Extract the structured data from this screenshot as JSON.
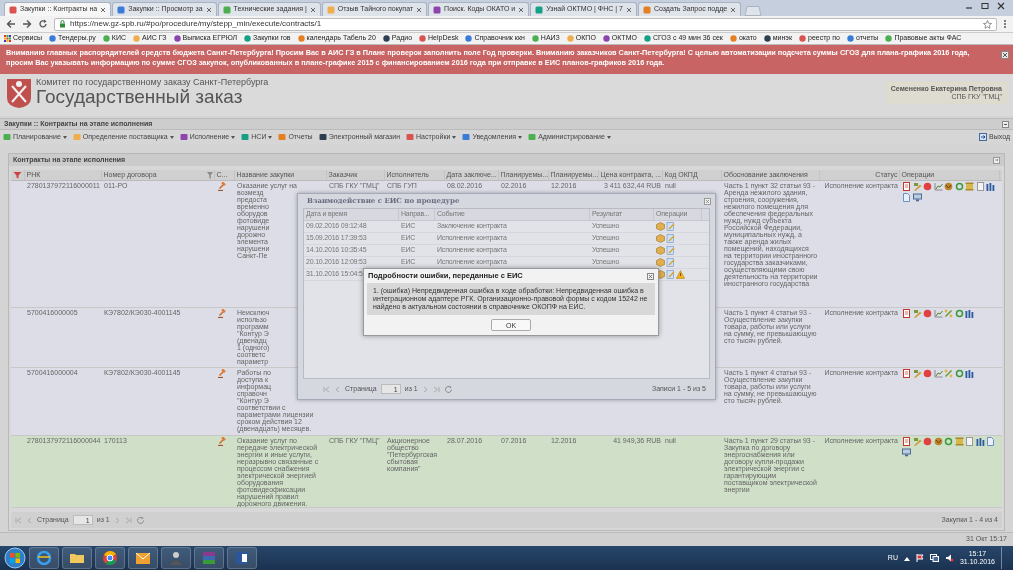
{
  "browser": {
    "tabs": [
      {
        "title": "Закупки :: Контракты на",
        "selected": true
      },
      {
        "title": "Закупки :: Просмотр за",
        "selected": false
      },
      {
        "title": "Технические задания |",
        "selected": false
      },
      {
        "title": "Отзыв Тайного покупат",
        "selected": false
      },
      {
        "title": "Поиск. Коды ОКАТО и",
        "selected": false
      },
      {
        "title": "Узнай ОКТМО | ФНС | 7",
        "selected": false
      },
      {
        "title": "Создать Запрос подде",
        "selected": false
      }
    ],
    "url": "https://new.gz-spb.ru/#po/procedure/my/stepp_min/execute/contracts/1",
    "bookmarks": [
      "Сервисы",
      "Тендеры.ру",
      "КИС",
      "АИС ГЗ",
      "Выписка ЕГРЮЛ",
      "Закупки гов",
      "календарь Табель 20",
      "Радио",
      "HelpDesk",
      "Справочник ккн",
      "НАИЗ",
      "ОКПО",
      "ОКТМО",
      "СГОЗ с 49 мин 36 сек",
      "окато",
      "минэк",
      "реестр по",
      "отчеты",
      "Правовые акты ФАС"
    ]
  },
  "banner": "Вниманию главных распорядителей средств бюджета Санкт-Петербурга! Просим Вас в АИС ГЗ в Плане проверок заполнить поле Год проверки. Вниманию заказчиков Санкт-Петербурга! С целью автоматизации подсчета суммы СГОЗ для плана-графика 2016 года, просим Вас указывать информацию по сумме СГОЗ закупок, опубликованных в плане-графике 2015 с финансированием 2016 года при отправке в ЕИС планов-графиков 2016 года.",
  "header": {
    "org": "Комитет по государственному заказу Санкт-Петербурга",
    "title": "Государственный заказ",
    "user_name": "Семененко Екатерина Петровна",
    "user_org": "СПБ ГКУ \"ГМЦ\""
  },
  "breadcrumb": "Закупки :: Контракты на этапе исполнения",
  "toolbar": {
    "menus": [
      {
        "label": "Планирование",
        "dropdown": true
      },
      {
        "label": "Определение поставщика",
        "dropdown": true
      },
      {
        "label": "Исполнение",
        "dropdown": true
      },
      {
        "label": "НСИ",
        "dropdown": true
      },
      {
        "label": "Отчеты",
        "dropdown": false
      },
      {
        "label": "Электронный магазин",
        "dropdown": false
      },
      {
        "label": "Настройки",
        "dropdown": true
      },
      {
        "label": "Уведомления",
        "dropdown": true
      },
      {
        "label": "Администрирование",
        "dropdown": true
      }
    ],
    "exit": "Выход"
  },
  "grid": {
    "title": "Контракты на этапе исполнения",
    "columns": [
      "РНК",
      "Номер договора",
      "С...",
      "Название закупки",
      "Заказчик",
      "Исполнитель",
      "Дата заключе...",
      "Планируемы...",
      "Планируемы...",
      "Цена контракта, ...",
      "Код ОКПД",
      "Обоснование заключения",
      "Статус",
      "Операции"
    ],
    "rows": [
      {
        "rnk": "2780137972116000011",
        "number": "011-РО",
        "name": "Оказание услуг на\nвозмезд\nпредоста\nвременно\nоборудов\nфотовиде\nнарушени\nдорожно\nэлемента\nнарушени\nСанкт-Пе",
        "customer": "СПБ ГКУ \"ГМЦ\"",
        "executor": "СПБ ГУП",
        "date": "08.02.2016",
        "plan_start": "02.2016",
        "plan_end": "12.2016",
        "price": "3 411 632,44 RUB",
        "okpd": "null",
        "basis": "Часть 1 пункт 32 статьи 93 - Аренда нежилого здания, строения, сооружения, нежилого помещения для обеспечения федеральных нужд, нужд субъекта Российской Федерации, муниципальных нужд, а также аренда жилых помещений, находящихся на территории иностранного государства заказчиками, осуществляющими свою деятельность на территории иностранного государства",
        "status": "Исполнение контракта",
        "operations": [
          {
            "kind": "doc"
          },
          {
            "kind": "pen"
          },
          {
            "kind": "stop"
          },
          {
            "kind": "chart"
          },
          {
            "kind": "emblem"
          },
          {
            "kind": "cycle"
          },
          {
            "kind": "scroll"
          },
          {
            "kind": "page"
          },
          {
            "kind": "bars"
          },
          {
            "kind": "sheet"
          },
          {
            "kind": "monitor"
          }
        ],
        "selected": false
      },
      {
        "rnk": "5700416000005",
        "number": "КЭ7802/КЭ030-4001145",
        "name": "Неисключ\nиспользо\nпрограмм\n\"Контур Э\n(двенадц\n1 (одного)\nсоответс\nпараметр",
        "basis": "Часть 1 пункт 4 статьи 93 - Осуществление закупки товара, работы или услуги на сумму, не превышающую сто тысяч рублей.",
        "status": "Исполнение контракта",
        "operations": [
          {
            "kind": "doc"
          },
          {
            "kind": "pen"
          },
          {
            "kind": "stop"
          },
          {
            "kind": "chart"
          },
          {
            "kind": "tool"
          },
          {
            "kind": "cycle"
          },
          {
            "kind": "bars"
          }
        ],
        "selected": false
      },
      {
        "rnk": "5700416000004",
        "number": "КЭ7802/КЭ030-4001145",
        "name": "Работы по\nдоступа к\nинформац\nсправочн\n\"Контур Э\nсоответствии с\nпараметрами лицензии\nсроком действия 12\n(двенадцать) месяцев.",
        "basis": "Часть 1 пункт 4 статьи 93 - Осуществление закупки товара, работы или услуги на сумму, не превышающую сто тысяч рублей.",
        "status": "Исполнение контракта",
        "operations": [
          {
            "kind": "doc"
          },
          {
            "kind": "pen"
          },
          {
            "kind": "stop"
          },
          {
            "kind": "chart"
          },
          {
            "kind": "tool"
          },
          {
            "kind": "cycle"
          },
          {
            "kind": "bars"
          }
        ],
        "selected": false
      },
      {
        "rnk": "2780137972116000044",
        "number": "170113",
        "name": "Оказание услуг по\nпередаче электрической\nэнергии и иные услуги,\nнеразрывно связанные с\nпроцессом снабжения\nэлектрической энергией\nоборудования\nфотовидеофиксации\nнарушений правил\nдорожного движения.",
        "customer": "СПБ ГКУ \"ГМЦ\"",
        "executor": "Акционерное\nобщество\n\"Петербургская\nсбытовая\nкомпания\"",
        "date": "28.07.2016",
        "plan_start": "07.2016",
        "plan_end": "12.2016",
        "price": "41 949,36 RUB",
        "okpd": "null",
        "basis": "Часть 1 пункт 29 статьи 93 - Закупка по договору энергоснабжения или договору купли-продажи электрической энергии с гарантирующим поставщиком электрической энергии",
        "status": "Исполнение контракта",
        "operations": [
          {
            "kind": "doc"
          },
          {
            "kind": "pen"
          },
          {
            "kind": "stop"
          },
          {
            "kind": "emblem"
          },
          {
            "kind": "cycle"
          },
          {
            "kind": "scroll"
          },
          {
            "kind": "page"
          },
          {
            "kind": "bars"
          },
          {
            "kind": "sheet"
          },
          {
            "kind": "monitor"
          }
        ],
        "selected": true
      }
    ],
    "pager": {
      "label": "Страница",
      "page": "1",
      "of": "из 1",
      "summary": "Закупки 1 - 4 из 4"
    }
  },
  "eis_dialog": {
    "title": "Взаимодействие с ЕИС по процедуре",
    "columns": [
      "Дата и время",
      "Направ...",
      "Событие",
      "Результат",
      "Операции"
    ],
    "rows": [
      {
        "date": "09.02.2016 09:12:48",
        "direction": "ЕИС",
        "event": "Заключение контракта",
        "result": "Успешно",
        "warning": false
      },
      {
        "date": "15.09.2016 17:39:53",
        "direction": "ЕИС",
        "event": "Исполнение контракта",
        "result": "Успешно",
        "warning": false
      },
      {
        "date": "14.10.2016 10:35:45",
        "direction": "ЕИС",
        "event": "Исполнение контракта",
        "result": "Успешно",
        "warning": false
      },
      {
        "date": "20.10.2016 12:09:53",
        "direction": "ЕИС",
        "event": "Исполнение контракта",
        "result": "Успешно",
        "warning": false
      },
      {
        "date": "31.10.2016 15:04:5",
        "warning": true
      }
    ],
    "pager": {
      "label": "Страница",
      "page": "1",
      "of": "из 1",
      "summary": "Записи 1 - 5 из 5"
    }
  },
  "error_dialog": {
    "title": "Подробности ошибки, переданные с ЕИС",
    "message": "1. (ошибка) Непредвиденная ошибка в ходе обработки: Непредвиденная ошибка в интеграционном адаптере РГК. Организационно-правовой формы с кодом 15242 не найдено в актуальном состоянии в справочнике ОКОПФ на ЕИС.",
    "button": "OK"
  },
  "status_bar": {
    "datetime": "31 Окт 15:17"
  },
  "taskbar": {
    "language": "RU",
    "time": "15:17",
    "date": "31.10.2016"
  }
}
